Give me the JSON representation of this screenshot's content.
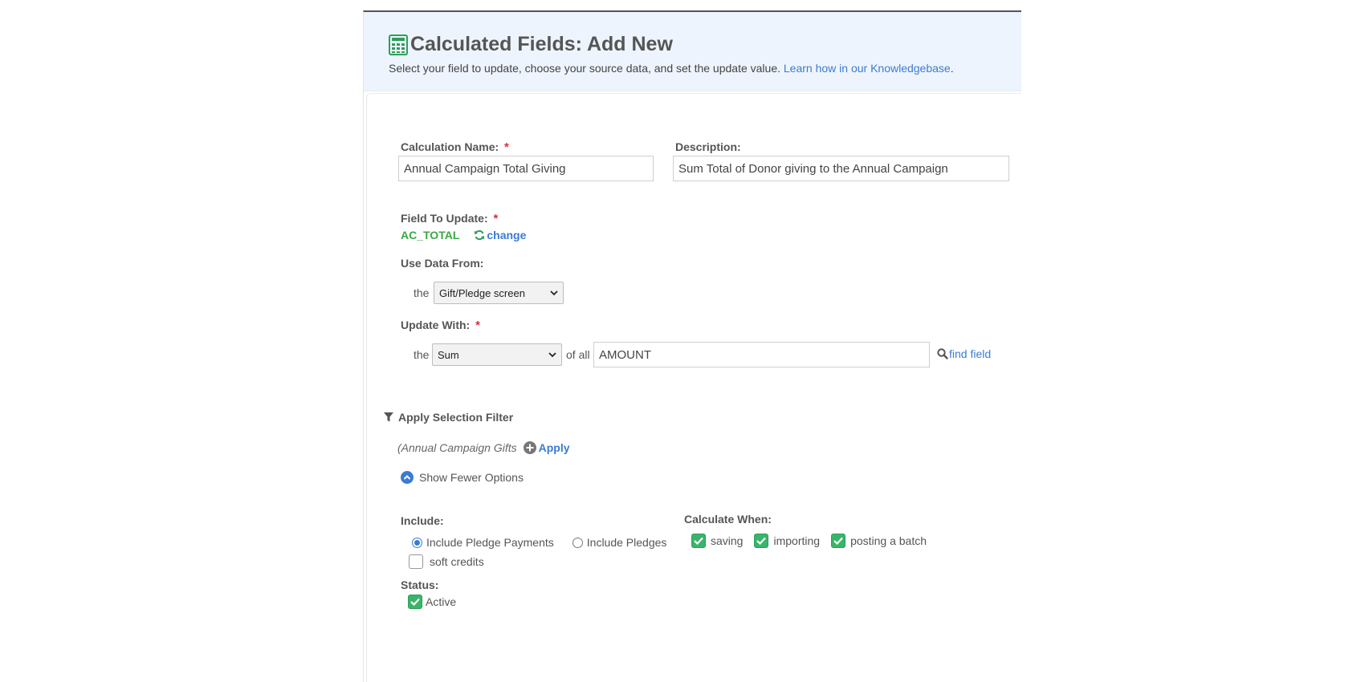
{
  "header": {
    "title": "Calculated Fields: Add New",
    "subtitle": "Select your field to update, choose your source data, and set the update value. ",
    "kb_link": "Learn how in our Knowledgebase",
    "kb_suffix": "."
  },
  "calc_name": {
    "label": "Calculation Name:",
    "required": "*",
    "value": "Annual Campaign Total Giving"
  },
  "description": {
    "label": "Description:",
    "value": "Sum Total of Donor giving to the Annual Campaign"
  },
  "field_to_update": {
    "label": "Field To Update:",
    "required": "*",
    "value": "AC_TOTAL",
    "change_label": "change"
  },
  "use_data_from": {
    "label": "Use Data From:",
    "prefix": "the",
    "selected": "Gift/Pledge screen"
  },
  "update_with": {
    "label": "Update With:",
    "required": "*",
    "prefix": "the",
    "selected": "Sum",
    "of_all": "of all",
    "field_value": "AMOUNT",
    "find_field": "find field"
  },
  "filter": {
    "label": "Apply Selection Filter",
    "filter_name": "(Annual Campaign Gifts",
    "apply_label": "Apply"
  },
  "options_toggle": {
    "label": "Show Fewer Options"
  },
  "include": {
    "label": "Include:",
    "options": [
      "Include Pledge Payments",
      "Include Pledges"
    ],
    "selected": "Include Pledge Payments",
    "soft_credits": "soft credits",
    "soft_credits_checked": false
  },
  "calculate_when": {
    "label": "Calculate When:",
    "options": [
      {
        "label": "saving",
        "checked": true
      },
      {
        "label": "importing",
        "checked": true
      },
      {
        "label": "posting a batch",
        "checked": true
      }
    ]
  },
  "status": {
    "label": "Status:",
    "active_label": "Active",
    "active_checked": true
  },
  "colors": {
    "accent": "#3a7bd5",
    "success": "#38b56a",
    "required": "#d9303e",
    "field_green": "#3aa845",
    "header_bg": "#eef4fd"
  }
}
